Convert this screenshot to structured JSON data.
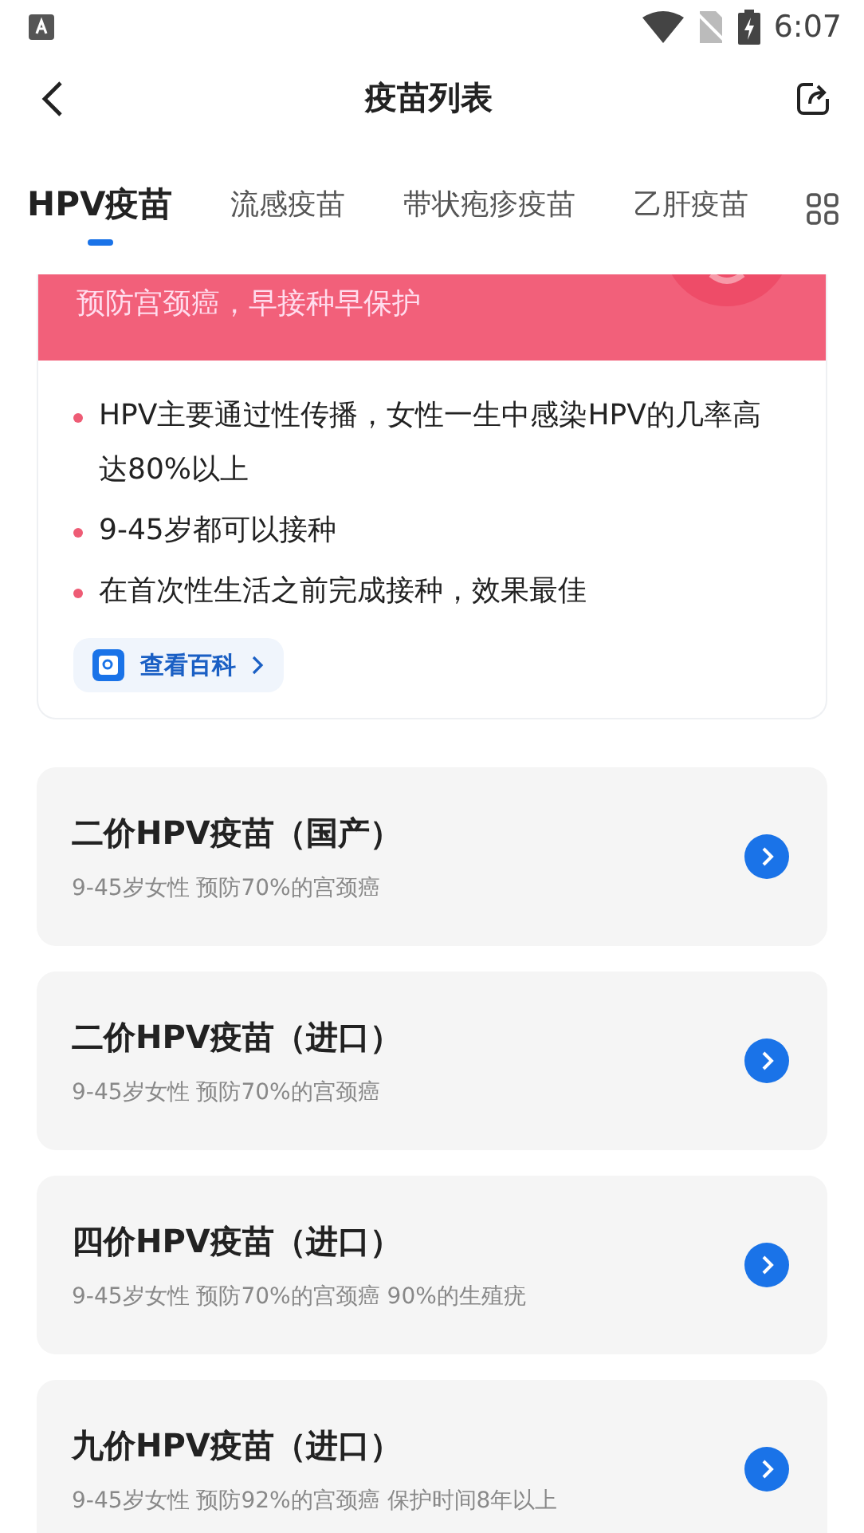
{
  "status_bar": {
    "time": "6:07"
  },
  "header": {
    "title": "疫苗列表"
  },
  "tabs": [
    {
      "label": "HPV疫苗",
      "selected": true
    },
    {
      "label": "流感疫苗",
      "selected": false
    },
    {
      "label": "带状疱疹疫苗",
      "selected": false
    },
    {
      "label": "乙肝疫苗",
      "selected": false
    }
  ],
  "banner": {
    "text": "预防宫颈癌，早接种早保护"
  },
  "facts": [
    "HPV主要通过性传播，女性一生中感染HPV的几率高达80%以上",
    "9-45岁都可以接种",
    "在首次性生活之前完成接种，效果最佳"
  ],
  "wiki_link": {
    "label": "查看百科"
  },
  "vaccines": [
    {
      "name": "二价HPV疫苗（国产）",
      "description": "9-45岁女性 预防70%的宫颈癌"
    },
    {
      "name": "二价HPV疫苗（进口）",
      "description": "9-45岁女性 预防70%的宫颈癌"
    },
    {
      "name": "四价HPV疫苗（进口）",
      "description": "9-45岁女性 预防70%的宫颈癌 90%的生殖疣"
    },
    {
      "name": "九价HPV疫苗（进口）",
      "description": "9-45岁女性 预防92%的宫颈癌 保护时间8年以上"
    }
  ]
}
